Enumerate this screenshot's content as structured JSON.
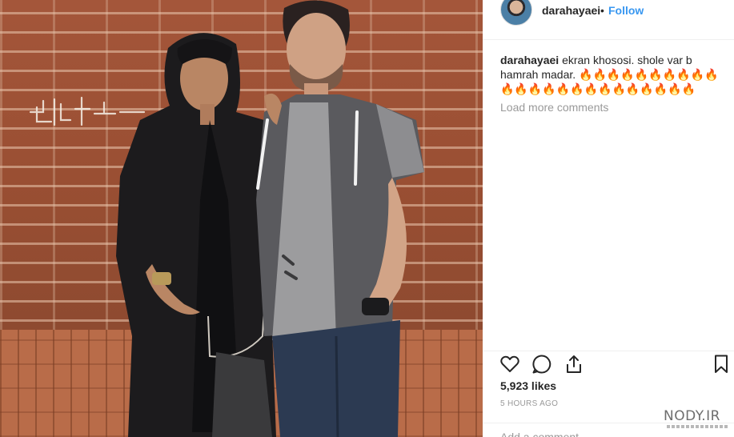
{
  "post": {
    "photo_alt": "Two people standing in front of a brick wall"
  },
  "header": {
    "username": "darahayaei",
    "separator": "•",
    "follow_label": "Follow"
  },
  "caption": {
    "username": "darahayaei",
    "text": "ekran khososi. shole var b hamrah madar.",
    "emojis": "🔥🔥🔥🔥🔥🔥🔥🔥🔥🔥🔥🔥🔥🔥🔥🔥🔥🔥🔥🔥🔥🔥🔥🔥"
  },
  "comments": {
    "load_more_label": "Load more comments"
  },
  "actions": {
    "icons": [
      "heart-icon",
      "comment-icon",
      "share-icon",
      "bookmark-icon"
    ]
  },
  "stats": {
    "likes": "5,923 likes",
    "timestamp": "5 HOURS AGO"
  },
  "comment_box": {
    "placeholder": "Add a comment…"
  },
  "watermark": {
    "text": "NODY.IR"
  },
  "colors": {
    "link_blue": "#3897f0",
    "text_primary": "#262626",
    "text_secondary": "#999999",
    "divider": "#efefef"
  }
}
